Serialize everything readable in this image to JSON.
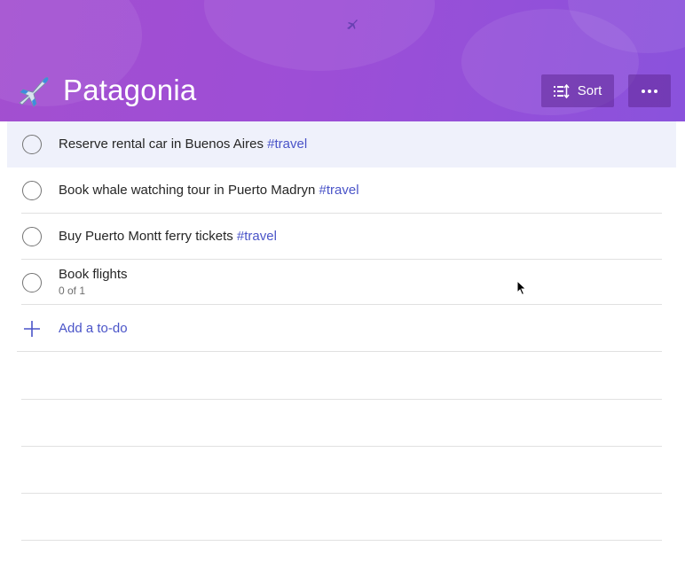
{
  "list": {
    "title": "Patagonia",
    "emoji_icon": "airplane-emoji",
    "accent_color": "#4a54c8",
    "header_gradient": [
      "#a34fd0",
      "#8a52dc"
    ]
  },
  "toolbar": {
    "sort_label": "Sort",
    "sort_icon": "sort-icon",
    "more_icon": "ellipsis-icon"
  },
  "tasks": [
    {
      "text": "Reserve rental car in Buenos Aires ",
      "tag": "#travel",
      "selected": true
    },
    {
      "text": "Book whale watching tour in Puerto Madryn ",
      "tag": "#travel"
    },
    {
      "text": "Buy Puerto Montt ferry tickets ",
      "tag": "#travel"
    },
    {
      "text": "Book flights",
      "subtitle": "0 of 1"
    }
  ],
  "add_todo": {
    "label": "Add a to-do",
    "icon": "plus-icon"
  }
}
